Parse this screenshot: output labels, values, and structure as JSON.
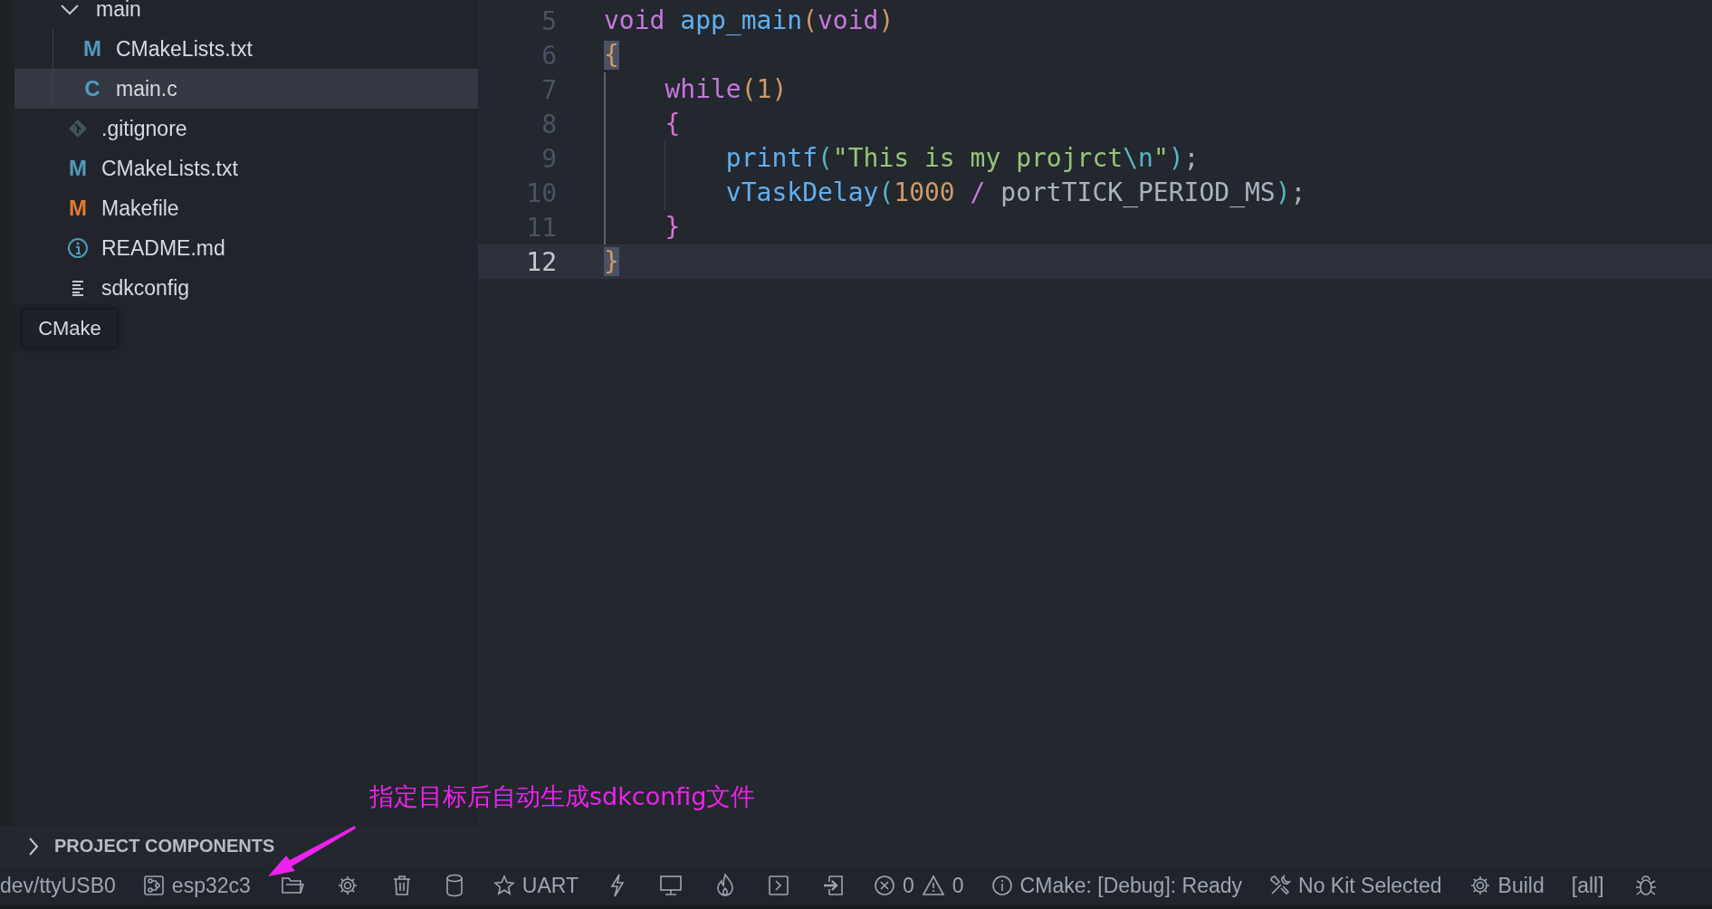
{
  "sidebar": {
    "tree": [
      {
        "name": "main",
        "kind": "folder",
        "expanded": true,
        "selected": false,
        "children": [
          {
            "name": "CMakeLists.txt",
            "kind": "cmake",
            "badge": "M",
            "selected": false
          },
          {
            "name": "main.c",
            "kind": "c",
            "badge": "C",
            "selected": true
          }
        ]
      },
      {
        "name": ".gitignore",
        "kind": "git",
        "selected": false
      },
      {
        "name": "CMakeLists.txt",
        "kind": "cmake",
        "badge": "M",
        "selected": false
      },
      {
        "name": "Makefile",
        "kind": "make",
        "badge": "M",
        "selected": false
      },
      {
        "name": "README.md",
        "kind": "info",
        "selected": false
      },
      {
        "name": "sdkconfig",
        "kind": "text",
        "selected": false
      }
    ],
    "tooltip": "CMake",
    "section": {
      "title": "PROJECT COMPONENTS",
      "expanded": false
    }
  },
  "editor": {
    "lines": [
      {
        "number": "5",
        "current": false,
        "tokens": [
          {
            "text": "void ",
            "kind": "keyword"
          },
          {
            "text": "app_main",
            "kind": "function"
          },
          {
            "text": "(",
            "kind": "bracket_a"
          },
          {
            "text": "void",
            "kind": "keyword"
          },
          {
            "text": ")",
            "kind": "bracket_a"
          }
        ]
      },
      {
        "number": "6",
        "current": false,
        "tokens": [
          {
            "text": "{",
            "kind": "brace_match"
          }
        ]
      },
      {
        "number": "7",
        "current": false,
        "guides": [
          {
            "kind": "active"
          }
        ],
        "tokens": [
          {
            "text": "while",
            "kind": "keyword"
          },
          {
            "text": "(",
            "kind": "bracket_a"
          },
          {
            "text": "1",
            "kind": "number"
          },
          {
            "text": ")",
            "kind": "bracket_a"
          }
        ]
      },
      {
        "number": "8",
        "current": false,
        "guides": [
          {
            "kind": "active"
          }
        ],
        "tokens": [
          {
            "text": "{",
            "kind": "bracket_b"
          }
        ]
      },
      {
        "number": "9",
        "current": false,
        "guides": [
          {
            "kind": "active"
          },
          {
            "kind": "plain"
          }
        ],
        "tokens": [
          {
            "text": "printf",
            "kind": "function"
          },
          {
            "text": "(",
            "kind": "bracket_c"
          },
          {
            "text": "\"This is my projrct",
            "kind": "string"
          },
          {
            "text": "\\n",
            "kind": "escape"
          },
          {
            "text": "\"",
            "kind": "string"
          },
          {
            "text": ")",
            "kind": "bracket_c"
          },
          {
            "text": ";",
            "kind": "plain"
          }
        ]
      },
      {
        "number": "10",
        "current": false,
        "guides": [
          {
            "kind": "active"
          },
          {
            "kind": "plain"
          }
        ],
        "tokens": [
          {
            "text": "vTaskDelay",
            "kind": "function"
          },
          {
            "text": "(",
            "kind": "bracket_c"
          },
          {
            "text": "1000 ",
            "kind": "number"
          },
          {
            "text": "/",
            "kind": "operator"
          },
          {
            "text": " portTICK_PERIOD_MS",
            "kind": "plain"
          },
          {
            "text": ")",
            "kind": "bracket_c"
          },
          {
            "text": ";",
            "kind": "plain"
          }
        ]
      },
      {
        "number": "11",
        "current": false,
        "guides": [
          {
            "kind": "active"
          }
        ],
        "tokens": [
          {
            "text": "}",
            "kind": "bracket_b"
          }
        ]
      },
      {
        "number": "12",
        "current": true,
        "tokens": [
          {
            "text": "}",
            "kind": "brace_match"
          }
        ]
      }
    ]
  },
  "status_bar": [
    {
      "kind": "text",
      "label": "dev/ttyUSB0"
    },
    {
      "kind": "chip",
      "label": "esp32c3"
    },
    {
      "kind": "folder"
    },
    {
      "kind": "gear"
    },
    {
      "kind": "trash"
    },
    {
      "kind": "database"
    },
    {
      "kind": "star",
      "label": "UART"
    },
    {
      "kind": "lightning"
    },
    {
      "kind": "monitor"
    },
    {
      "kind": "flame"
    },
    {
      "kind": "terminal"
    },
    {
      "kind": "arrow-box"
    },
    {
      "kind": "problems",
      "errors": "0",
      "warnings": "0"
    },
    {
      "kind": "info",
      "label": "CMake: [Debug]: Ready"
    },
    {
      "kind": "tools",
      "label": "No Kit Selected"
    },
    {
      "kind": "gear",
      "label": "Build"
    },
    {
      "kind": "text",
      "label": "[all]"
    },
    {
      "kind": "bug"
    }
  ],
  "annotation": "指定目标后自动生成sdkconfig文件"
}
